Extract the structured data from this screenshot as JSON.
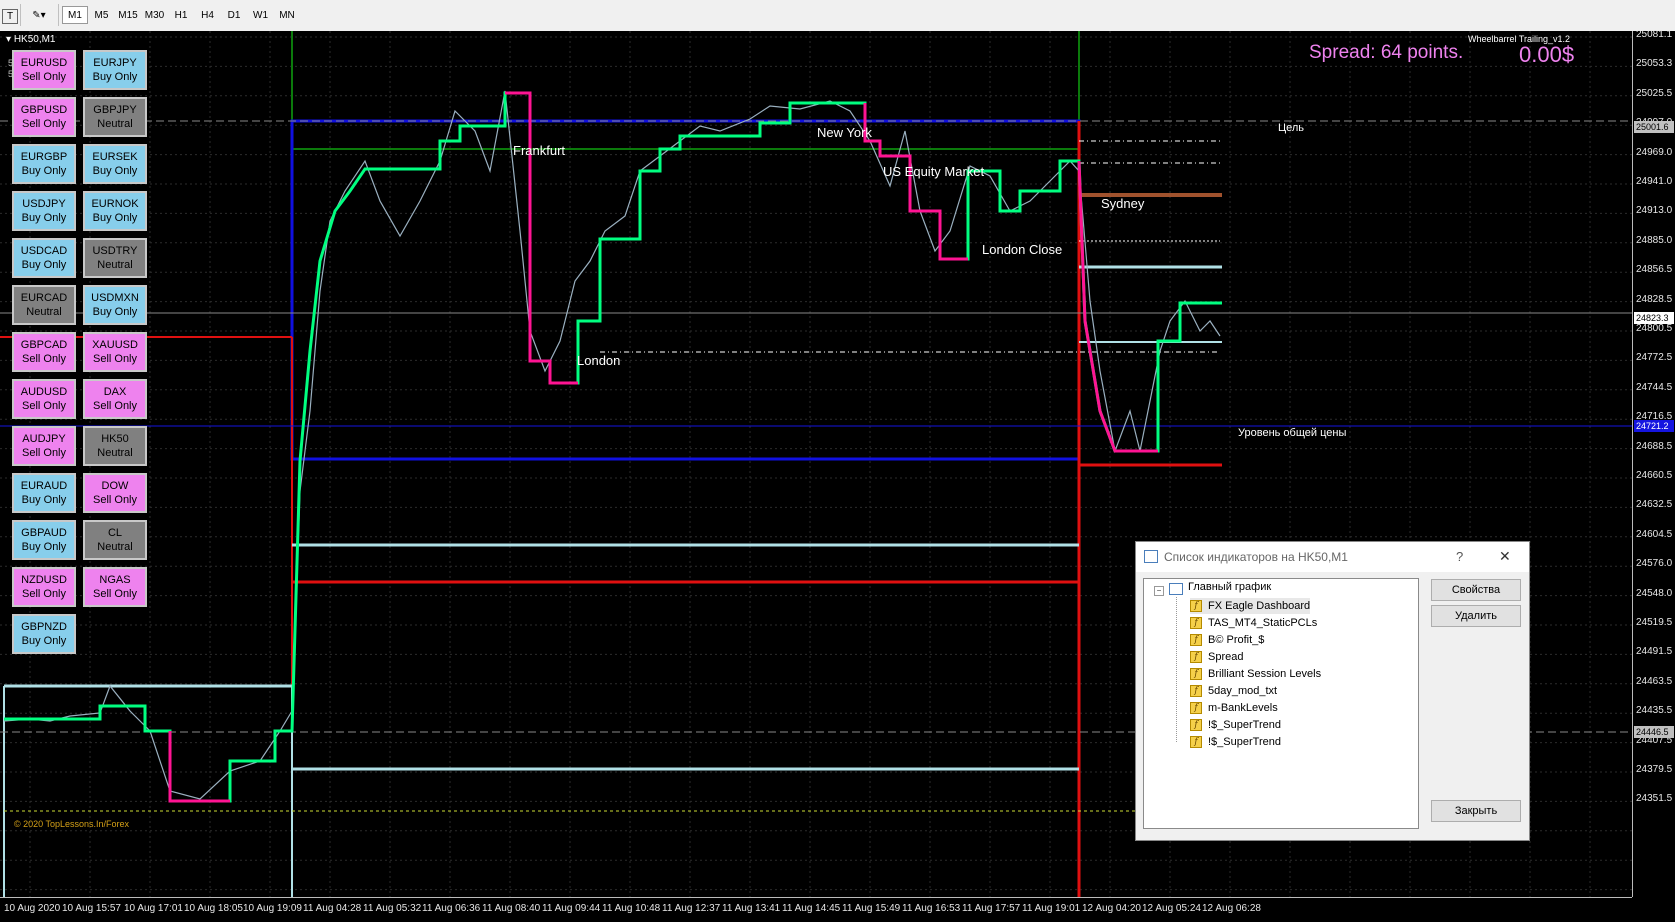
{
  "toolbar": {
    "timeframes": [
      "M1",
      "M5",
      "M15",
      "M30",
      "H1",
      "H4",
      "D1",
      "W1",
      "MN"
    ],
    "active": "M1"
  },
  "chart": {
    "symbol_title": "HK50,M1",
    "spread_text": "Spread: 64 points.",
    "profit_text": "0.00$",
    "indicator_name": "Wheelbarrel Trailing_v1.2",
    "copyright": "© 2020 TopLessons.In/Forex",
    "overlay_text_1": "5day",
    "overlay_text_2": "5day",
    "session_labels": {
      "frankfurt": "Frankfurt",
      "new_york": "New York",
      "us_equity": "US Equity Market",
      "sydney": "Sydney",
      "london_close": "London Close",
      "london": "London"
    },
    "level_labels": {
      "target": "Цель",
      "common_price": "Уровень общей цены"
    }
  },
  "dashboard": [
    {
      "pair": "EURUSD",
      "status": "Sell Only",
      "kind": "sell"
    },
    {
      "pair": "EURJPY",
      "status": "Buy Only",
      "kind": "buy"
    },
    {
      "pair": "GBPUSD",
      "status": "Sell Only",
      "kind": "sell"
    },
    {
      "pair": "GBPJPY",
      "status": "Neutral",
      "kind": "neutral"
    },
    {
      "pair": "EURGBP",
      "status": "Buy Only",
      "kind": "buy"
    },
    {
      "pair": "EURSEK",
      "status": "Buy Only",
      "kind": "buy"
    },
    {
      "pair": "USDJPY",
      "status": "Buy Only",
      "kind": "buy"
    },
    {
      "pair": "EURNOK",
      "status": "Buy Only",
      "kind": "buy"
    },
    {
      "pair": "USDCAD",
      "status": "Buy Only",
      "kind": "buy"
    },
    {
      "pair": "USDTRY",
      "status": "Neutral",
      "kind": "neutral"
    },
    {
      "pair": "EURCAD",
      "status": "Neutral",
      "kind": "neutral"
    },
    {
      "pair": "USDMXN",
      "status": "Buy Only",
      "kind": "buy"
    },
    {
      "pair": "GBPCAD",
      "status": "Sell Only",
      "kind": "sell"
    },
    {
      "pair": "XAUUSD",
      "status": "Sell Only",
      "kind": "sell"
    },
    {
      "pair": "AUDUSD",
      "status": "Sell Only",
      "kind": "sell"
    },
    {
      "pair": "DAX",
      "status": "Sell Only",
      "kind": "sell"
    },
    {
      "pair": "AUDJPY",
      "status": "Sell Only",
      "kind": "sell"
    },
    {
      "pair": "HK50",
      "status": "Neutral",
      "kind": "neutral"
    },
    {
      "pair": "EURAUD",
      "status": "Buy Only",
      "kind": "buy"
    },
    {
      "pair": "DOW",
      "status": "Sell Only",
      "kind": "sell"
    },
    {
      "pair": "GBPAUD",
      "status": "Buy Only",
      "kind": "buy"
    },
    {
      "pair": "CL",
      "status": "Neutral",
      "kind": "neutral"
    },
    {
      "pair": "NZDUSD",
      "status": "Sell Only",
      "kind": "sell"
    },
    {
      "pair": "NGAS",
      "status": "Sell Only",
      "kind": "sell"
    },
    {
      "pair": "GBPNZD",
      "status": "Buy Only",
      "kind": "buy"
    }
  ],
  "colors": {
    "buy": "#87ceeb",
    "sell": "#ee82ee",
    "neutral": "#808080",
    "spread": "#ee82ee",
    "bull_line": "#00ff80",
    "bear_line": "#ff1493"
  },
  "price_scale": {
    "ticks": [
      "25081.1",
      "25053.3",
      "25025.5",
      "24997.0",
      "24969.0",
      "24941.0",
      "24913.0",
      "24885.0",
      "24856.5",
      "24828.5",
      "24800.5",
      "24772.5",
      "24744.5",
      "24716.5",
      "24688.5",
      "24660.5",
      "24632.5",
      "24604.5",
      "24576.0",
      "24548.0",
      "24519.5",
      "24491.5",
      "24463.5",
      "24435.5",
      "24407.5",
      "24379.5",
      "24351.5"
    ],
    "tag_target": "25001.6",
    "tag_current": "24823.3",
    "tag_common": "24721.2",
    "tag_low": "24446.5"
  },
  "time_axis": [
    "10 Aug 2020",
    "10 Aug 15:57",
    "10 Aug 17:01",
    "10 Aug 18:05",
    "10 Aug 19:09",
    "11 Aug 04:28",
    "11 Aug 05:32",
    "11 Aug 06:36",
    "11 Aug 08:40",
    "11 Aug 09:44",
    "11 Aug 10:48",
    "11 Aug 12:37",
    "11 Aug 13:41",
    "11 Aug 14:45",
    "11 Aug 15:49",
    "11 Aug 16:53",
    "11 Aug 17:57",
    "11 Aug 19:01",
    "12 Aug 04:20",
    "12 Aug 05:24",
    "12 Aug 06:28"
  ],
  "dialog": {
    "title": "Список индикаторов на HK50,M1",
    "help": "?",
    "close": "✕",
    "root": "Главный график",
    "indicators": [
      "FX Eagle Dashboard",
      "TAS_MT4_StaticPCLs",
      "B© Profit_$",
      "Spread",
      "Brilliant Session Levels",
      "5day_mod_txt",
      "m-BankLevels",
      "!$_SuperTrend",
      "!$_SuperTrend"
    ],
    "properties_button": "Свойства",
    "delete_button": "Удалить",
    "close_button": "Закрыть"
  }
}
